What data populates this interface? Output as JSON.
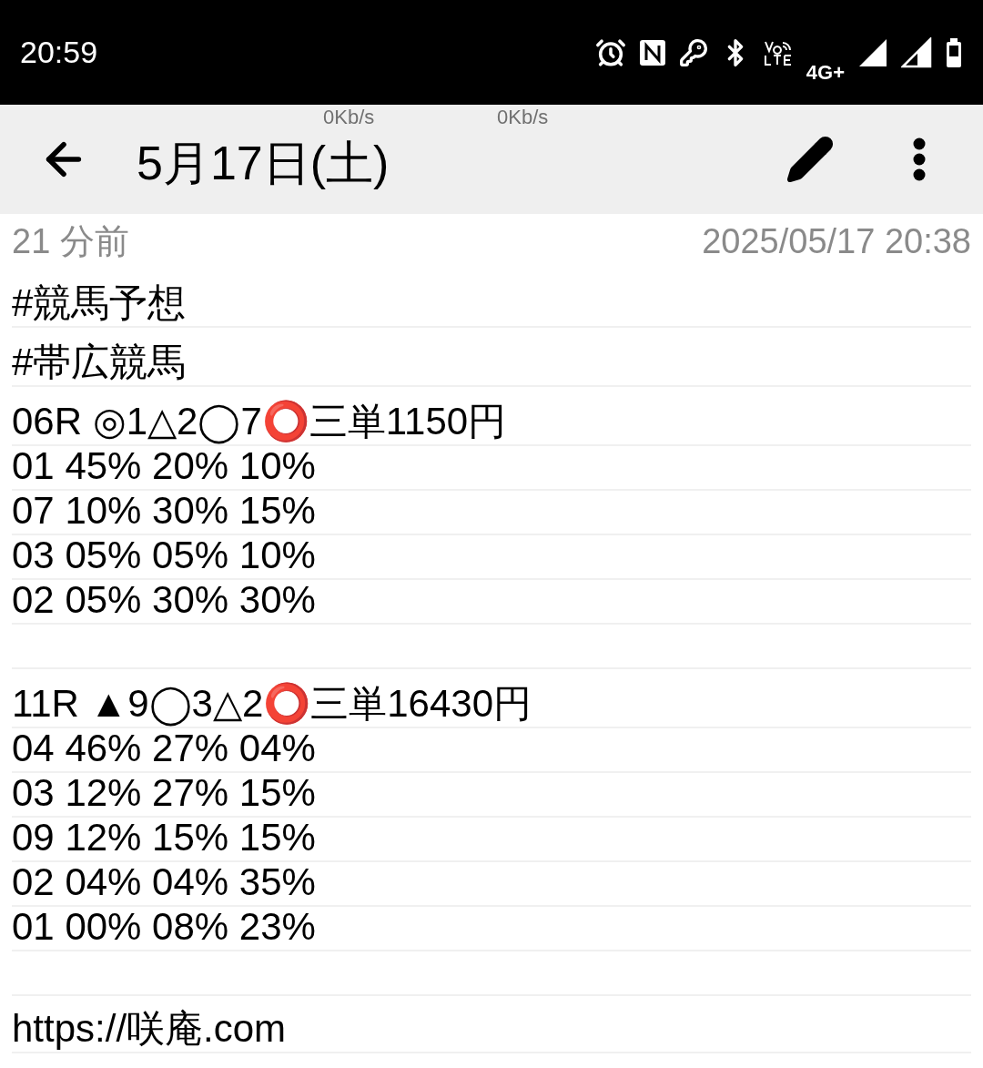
{
  "status_bar": {
    "time": "20:59",
    "network": "4G+"
  },
  "speed_overlay": [
    "0Kb/s",
    "0Kb/s"
  ],
  "toolbar": {
    "title": "5月17日(土)"
  },
  "meta": {
    "relative_time": "21 分前",
    "timestamp": "2025/05/17 20:38"
  },
  "lines": [
    {
      "kind": "tag",
      "text": "#競馬予想"
    },
    {
      "kind": "tag",
      "text": "#帯広競馬"
    },
    {
      "kind": "race",
      "text": "06R ◎1△2◯7⭕三単1150円"
    },
    {
      "kind": "odds",
      "text": "01 45% 20% 10%"
    },
    {
      "kind": "odds",
      "text": "07 10% 30% 15%"
    },
    {
      "kind": "odds",
      "text": "03 05% 05% 10%"
    },
    {
      "kind": "odds",
      "text": "02 05% 30% 30%"
    },
    {
      "kind": "blank"
    },
    {
      "kind": "race",
      "text": "11R ▲9◯3△2⭕三単16430円"
    },
    {
      "kind": "odds",
      "text": "04 46% 27% 04%"
    },
    {
      "kind": "odds",
      "text": "03 12% 27% 15%"
    },
    {
      "kind": "odds",
      "text": "09 12% 15% 15%"
    },
    {
      "kind": "odds",
      "text": "02 04% 04% 35%"
    },
    {
      "kind": "odds",
      "text": "01 00% 08% 23%"
    },
    {
      "kind": "blank"
    },
    {
      "kind": "link",
      "text": "https://咲庵.com"
    }
  ]
}
